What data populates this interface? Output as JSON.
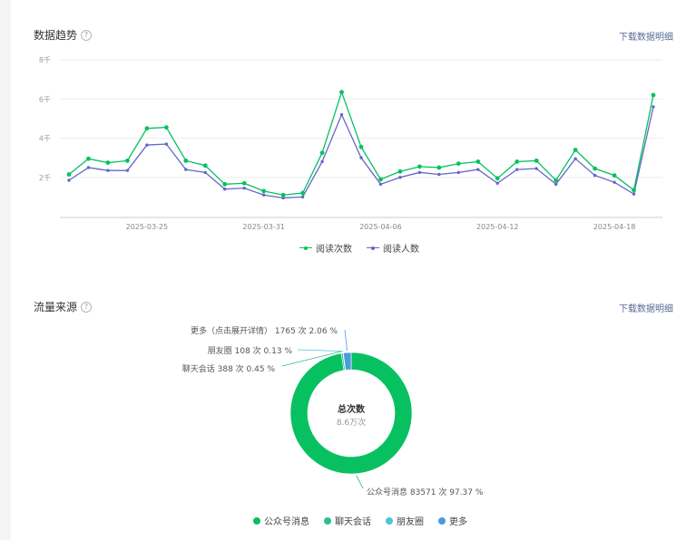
{
  "trend_section": {
    "title": "数据趋势",
    "help_icon": "question-circle-icon",
    "download_label": "下载数据明细"
  },
  "source_section": {
    "title": "流量来源",
    "help_icon": "question-circle-icon",
    "download_label": "下载数据明细"
  },
  "chart_data": [
    {
      "type": "line",
      "title": "",
      "xlabel": "",
      "ylabel": "",
      "ylim": [
        0,
        8000
      ],
      "y_ticks": [
        "2千",
        "4千",
        "6千",
        "8千"
      ],
      "y_tick_values": [
        2000,
        4000,
        6000,
        8000
      ],
      "grid": true,
      "legend_placement": "bottom-center",
      "x": [
        "2025-03-21",
        "2025-03-22",
        "2025-03-23",
        "2025-03-24",
        "2025-03-25",
        "2025-03-26",
        "2025-03-27",
        "2025-03-28",
        "2025-03-29",
        "2025-03-30",
        "2025-03-31",
        "2025-04-01",
        "2025-04-02",
        "2025-04-03",
        "2025-04-04",
        "2025-04-05",
        "2025-04-06",
        "2025-04-07",
        "2025-04-08",
        "2025-04-09",
        "2025-04-10",
        "2025-04-11",
        "2025-04-12",
        "2025-04-13",
        "2025-04-14",
        "2025-04-15",
        "2025-04-16",
        "2025-04-17",
        "2025-04-18",
        "2025-04-19",
        "2025-04-20"
      ],
      "x_tick_labels": [
        "2025-03-25",
        "2025-03-31",
        "2025-04-06",
        "2025-04-12",
        "2025-04-18"
      ],
      "series": [
        {
          "name": "阅读次数",
          "color": "#07c160",
          "values": [
            2150,
            2950,
            2750,
            2850,
            4500,
            4550,
            2850,
            2600,
            1650,
            1700,
            1300,
            1100,
            1200,
            3250,
            6350,
            3550,
            1900,
            2300,
            2550,
            2500,
            2700,
            2800,
            1950,
            2800,
            2850,
            1850,
            3400,
            2450,
            2100,
            1350,
            6200
          ]
        },
        {
          "name": "阅读人数",
          "color": "#6467c7",
          "values": [
            1850,
            2500,
            2350,
            2350,
            3650,
            3700,
            2400,
            2250,
            1400,
            1450,
            1100,
            950,
            1000,
            2800,
            5200,
            3000,
            1650,
            2000,
            2250,
            2150,
            2250,
            2400,
            1700,
            2400,
            2450,
            1650,
            2950,
            2100,
            1750,
            1150,
            5600
          ]
        }
      ]
    },
    {
      "type": "pie",
      "title": "",
      "center_label": "总次数",
      "center_value": "8.6万次",
      "legend_placement": "bottom-center",
      "slices": [
        {
          "name": "公众号消息",
          "value": 83571,
          "percent": 97.37,
          "color": "#07c160",
          "label": "公众号消息 83571 次 97.37 %"
        },
        {
          "name": "聊天会话",
          "value": 388,
          "percent": 0.45,
          "color": "#2fbf8a",
          "label": "聊天会话 388 次 0.45 %"
        },
        {
          "name": "朋友圈",
          "value": 108,
          "percent": 0.13,
          "color": "#4cc3e0",
          "label": "朋友圈 108 次 0.13 %"
        },
        {
          "name": "更多",
          "value": 1765,
          "percent": 2.06,
          "color": "#4b9be0",
          "label": "更多（点击展开详情） 1765 次 2.06 %"
        }
      ]
    }
  ]
}
